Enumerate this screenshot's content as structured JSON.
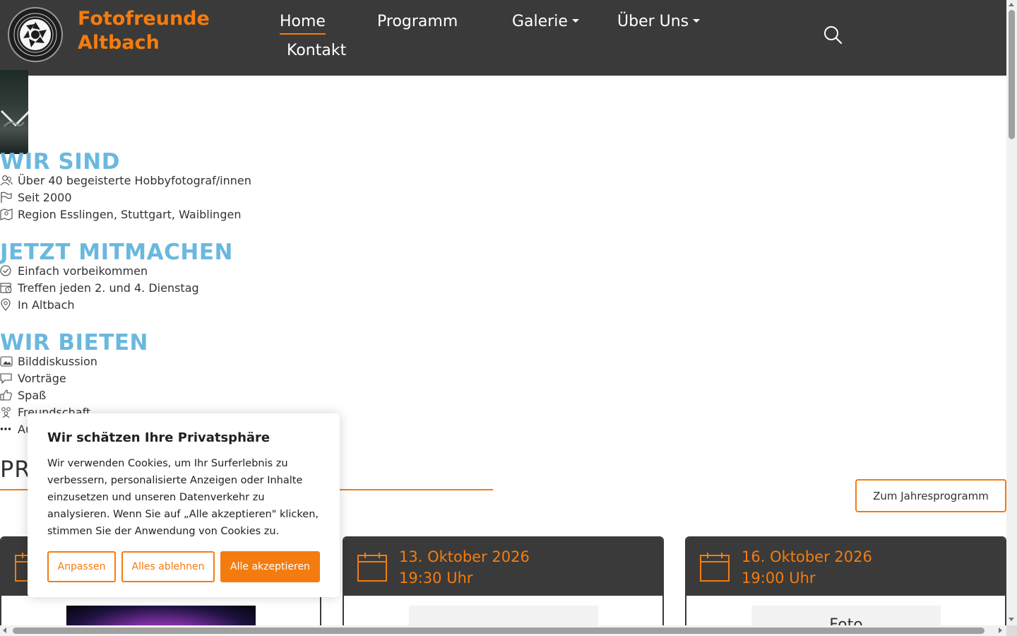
{
  "header": {
    "brand_line1": "Fotofreunde",
    "brand_line2": "Altbach",
    "logo_ring_text": "FOTOFREUNDE ALTBACH",
    "nav": {
      "home": "Home",
      "programm": "Programm",
      "galerie": "Galerie",
      "ueber_uns": "Über Uns",
      "kontakt": "Kontakt"
    },
    "search_icon": "search-icon"
  },
  "sections": {
    "wir_sind": {
      "title": "WIR SIND",
      "items": [
        {
          "icon": "users-icon",
          "text": "Über 40 begeisterte Hobbyfotograf/innen"
        },
        {
          "icon": "flag-icon",
          "text": "Seit 2000"
        },
        {
          "icon": "map-icon",
          "text": "Region Esslingen, Stuttgart, Waiblingen"
        }
      ]
    },
    "jetzt_mitmachen": {
      "title": "JETZT MITMACHEN",
      "items": [
        {
          "icon": "check-circle-icon",
          "text": "Einfach vorbeikommen"
        },
        {
          "icon": "calendar-clock-icon",
          "text": "Treffen jeden 2. und 4. Dienstag"
        },
        {
          "icon": "location-pin-icon",
          "text": "In Altbach"
        }
      ]
    },
    "wir_bieten": {
      "title": "WIR BIETEN",
      "items": [
        {
          "icon": "images-icon",
          "text": "Bilddiskussion"
        },
        {
          "icon": "speech-bubble-icon",
          "text": "Vorträge"
        },
        {
          "icon": "thumbs-up-icon",
          "text": "Spaß"
        },
        {
          "icon": "group-icon",
          "text": "Freundschaft"
        },
        {
          "icon": "more-dots-icon",
          "text": "Au"
        }
      ]
    }
  },
  "programm": {
    "title": "PR",
    "year_button": "Zum Jahresprogramm"
  },
  "events": [
    {
      "date": "",
      "time": "",
      "image_text": ""
    },
    {
      "date": "13. Oktober 2026",
      "time": "19:30 Uhr",
      "image_text": ""
    },
    {
      "date": "16. Oktober 2026",
      "time": "19:00 Uhr",
      "image_text": "Foto"
    }
  ],
  "cookie": {
    "title": "Wir schätzen Ihre Privatsphäre",
    "text": "Wir verwenden Cookies, um Ihr Surferlebnis zu verbessern, personalisierte Anzeigen oder Inhalte einzusetzen und unseren Datenverkehr zu analysieren. Wenn Sie auf „Alle akzeptieren\" klicken, stimmen Sie der Anwendung von Cookies zu.",
    "btn_customize": "Anpassen",
    "btn_reject": "Alles ablehnen",
    "btn_accept": "Alle akzeptieren"
  },
  "colors": {
    "accent": "#f47c0f",
    "header_bg": "#3a3a3a",
    "section_title": "#6ab8de"
  }
}
